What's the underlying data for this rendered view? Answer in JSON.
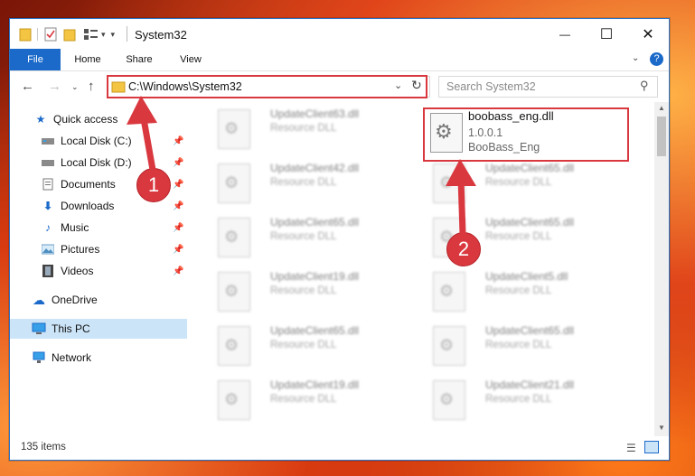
{
  "window": {
    "title": "System32",
    "close_glyph": "✕",
    "maximize_glyph": "☐",
    "minimize_glyph": "—"
  },
  "ribbon": {
    "tabs": [
      "File",
      "Home",
      "Share",
      "View"
    ]
  },
  "navigation": {
    "address": "C:\\Windows\\System32",
    "search_placeholder": "Search System32"
  },
  "sidebar": {
    "items": [
      {
        "label": "Quick access",
        "icon": "star-icon"
      },
      {
        "label": "Local Disk (C:)",
        "icon": "drive-icon",
        "pinned": true
      },
      {
        "label": "Local Disk (D:)",
        "icon": "drive-icon",
        "pinned": true
      },
      {
        "label": "Documents",
        "icon": "documents-icon",
        "pinned": true
      },
      {
        "label": "Downloads",
        "icon": "download-icon",
        "pinned": true
      },
      {
        "label": "Music",
        "icon": "music-icon",
        "pinned": true
      },
      {
        "label": "Pictures",
        "icon": "pictures-icon",
        "pinned": true
      },
      {
        "label": "Videos",
        "icon": "videos-icon",
        "pinned": true
      },
      {
        "label": "OneDrive",
        "icon": "cloud-icon"
      },
      {
        "label": "This PC",
        "icon": "computer-icon",
        "selected": true
      },
      {
        "label": "Network",
        "icon": "network-icon"
      }
    ]
  },
  "files": {
    "featured": {
      "name": "boobass_eng.dll",
      "version": "1.0.0.1",
      "description": "BooBass_Eng"
    },
    "blurred_left": [
      {
        "name": "UpdateClient63.dll",
        "desc": "Resource DLL"
      },
      {
        "name": "UpdateClient42.dll",
        "desc": "Resource DLL"
      },
      {
        "name": "UpdateClient65.dll",
        "desc": "Resource DLL"
      },
      {
        "name": "UpdateClient19.dll",
        "desc": "Resource DLL"
      },
      {
        "name": "UpdateClient65.dll",
        "desc": "Resource DLL"
      },
      {
        "name": "UpdateClient19.dll",
        "desc": "Resource DLL"
      }
    ],
    "blurred_right": [
      {
        "name": "UpdateClient65.dll",
        "desc": "Resource DLL"
      },
      {
        "name": "UpdateClient65.dll",
        "desc": "Resource DLL"
      },
      {
        "name": "UpdateClient5.dll",
        "desc": "Resource DLL"
      },
      {
        "name": "UpdateClient65.dll",
        "desc": "Resource DLL"
      },
      {
        "name": "UpdateClient21.dll",
        "desc": "Resource DLL"
      }
    ]
  },
  "status": {
    "count": "135 items"
  },
  "callouts": [
    "1",
    "2"
  ],
  "colors": {
    "accent": "#1b6ac9",
    "highlight": "#d9383f",
    "selected": "#cce4f7"
  }
}
